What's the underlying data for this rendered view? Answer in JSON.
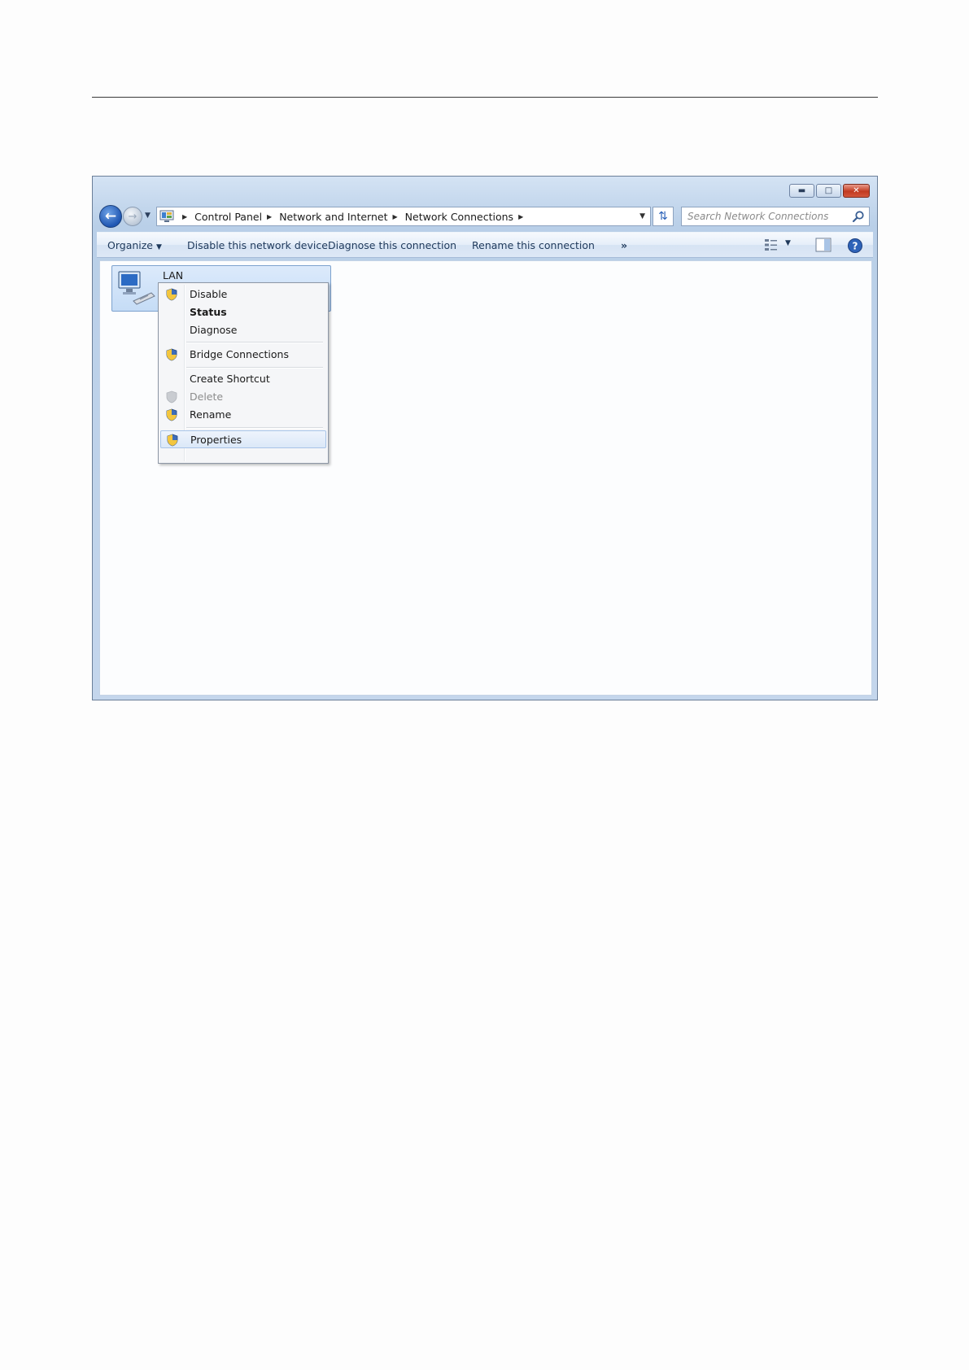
{
  "breadcrumb": {
    "items": [
      "Control Panel",
      "Network and Internet",
      "Network Connections"
    ]
  },
  "search": {
    "placeholder": "Search Network Connections"
  },
  "toolbar": {
    "organize": "Organize",
    "disable_device": "Disable this network device",
    "diagnose": "Diagnose this connection",
    "rename": "Rename this connection",
    "more": "»"
  },
  "connection": {
    "name": "LAN"
  },
  "context_menu": {
    "items": [
      {
        "label": "Disable",
        "icon": "uac-shield-icon"
      },
      {
        "label": "Status",
        "bold": true
      },
      {
        "label": "Diagnose"
      },
      {
        "label": "Bridge Connections",
        "icon": "uac-shield-icon"
      },
      {
        "label": "Create Shortcut"
      },
      {
        "label": "Delete",
        "icon": "uac-shield-icon",
        "disabled": true
      },
      {
        "label": "Rename",
        "icon": "uac-shield-icon"
      },
      {
        "label": "Properties",
        "icon": "uac-shield-icon",
        "highlighted": true
      }
    ]
  },
  "colors": {
    "window_frame": "#b9cfe8",
    "close_button": "#c23a20",
    "toolbar_text": "#1e395b"
  }
}
